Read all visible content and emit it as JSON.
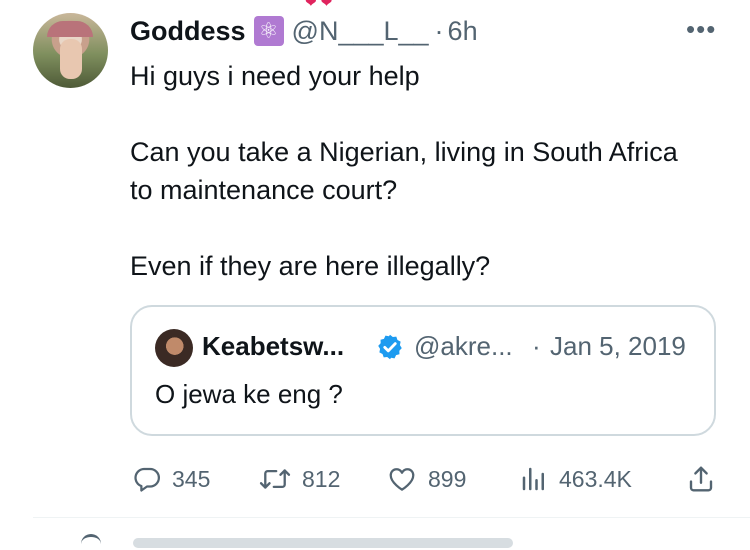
{
  "tweet": {
    "display_name": "Goddess",
    "badge_icon": "atom-icon",
    "handle": "@N___L__",
    "separator": "·",
    "time": "6h",
    "more_label": "•••",
    "text_lines": [
      "Hi guys i need your help",
      "",
      "Can you take a Nigerian, living in South Africa",
      "to maintenance court?",
      "",
      "Even if they are here illegally?"
    ]
  },
  "quote": {
    "display_name": "Keabetsw...",
    "verified": true,
    "handle": "@akre...",
    "separator": "·",
    "date": "Jan 5, 2019",
    "text": "O jewa ke eng ?"
  },
  "actions": {
    "replies": "345",
    "retweets": "812",
    "likes": "899",
    "views": "463.4K"
  },
  "colors": {
    "text": "#0f1419",
    "secondary": "#536471",
    "border": "#cfd9de",
    "verified": "#1d9bf0",
    "badge": "#b07ad2"
  }
}
